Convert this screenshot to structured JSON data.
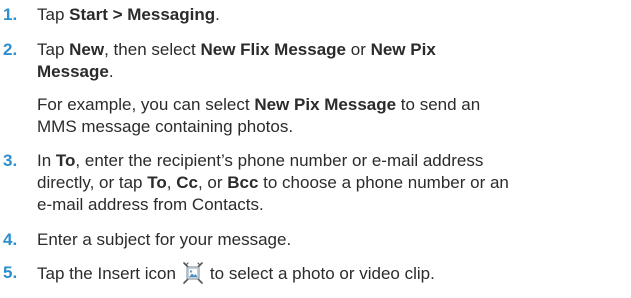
{
  "steps": [
    {
      "num": "1.",
      "parts": [
        "Tap ",
        "Start > Messaging",
        "."
      ]
    },
    {
      "num": "2.",
      "parts": [
        "Tap ",
        "New",
        ", then select ",
        "New Flix Message",
        " or ",
        "New Pix",
        "Message",
        "."
      ],
      "note": [
        "For example, you can select ",
        "New Pix Message",
        " to send an",
        "MMS message containing photos."
      ]
    },
    {
      "num": "3.",
      "parts": [
        "In ",
        "To",
        ", enter the recipient’s phone number or e-mail address",
        "directly, or tap ",
        "To",
        ", ",
        "Cc",
        ", or ",
        "Bcc",
        " to choose a phone number or an",
        "e-mail address from Contacts."
      ]
    },
    {
      "num": "4.",
      "parts": [
        "Enter a subject for your message."
      ]
    },
    {
      "num": "5.",
      "parts": [
        "Tap the Insert icon",
        "to select a photo or video clip."
      ],
      "icon": "insert-media-icon"
    }
  ],
  "colors": {
    "number": "#2d8fcf",
    "text": "#2b2b2b"
  }
}
